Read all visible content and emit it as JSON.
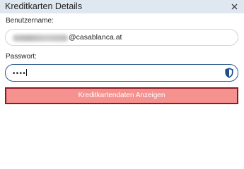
{
  "dialog": {
    "title": "Kreditkarten Details",
    "close_icon": "close-icon"
  },
  "username": {
    "label": "Benutzername:",
    "value_domain": "@casablanca.at"
  },
  "password": {
    "label": "Passwort:",
    "masked_value": "••••",
    "icon": "shield-icon"
  },
  "action": {
    "label": "Kreditkartendaten Anzeigen"
  },
  "colors": {
    "header_bg": "#dfe7f1",
    "button_fill": "#f5928f",
    "button_border": "#8a1a24",
    "focus_border": "#2c5a8c"
  }
}
